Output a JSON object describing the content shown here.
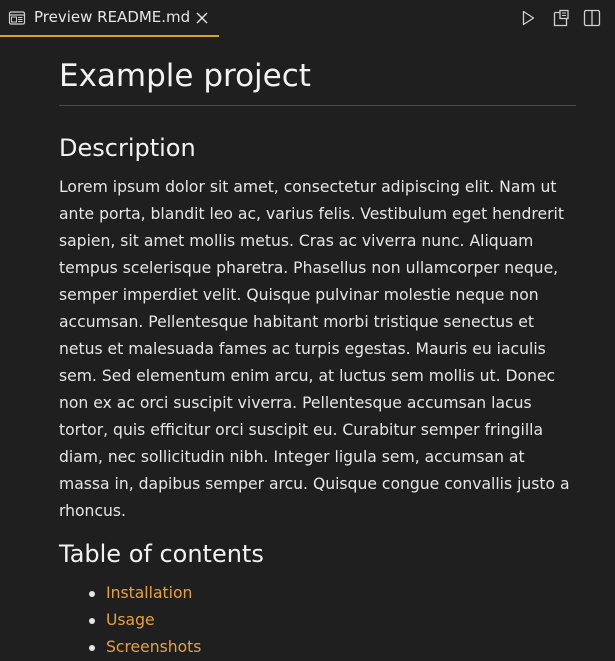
{
  "tab": {
    "icon": "preview-icon",
    "label": "Preview README.md",
    "close_icon": "close-icon"
  },
  "toolbar": {
    "run_icon": "play-icon",
    "open_source_icon": "open-file-icon",
    "split_icon": "split-editor-icon"
  },
  "colors": {
    "background": "#1f1f1f",
    "text": "#e6e6e6",
    "link": "#e8a23a",
    "active_tab_border": "#e0a030"
  },
  "document": {
    "title": "Example project",
    "description_heading": "Description",
    "description_text": "Lorem ipsum dolor sit amet, consectetur adipiscing elit. Nam ut ante porta, blandit leo ac, varius felis. Vestibulum eget hendrerit sapien, sit amet mollis metus. Cras ac viverra nunc. Aliquam tempus scelerisque pharetra. Phasellus non ullamcorper neque, semper imperdiet velit. Quisque pulvinar molestie neque non accumsan. Pellentesque habitant morbi tristique senectus et netus et malesuada fames ac turpis egestas. Mauris eu iaculis sem. Sed elementum enim arcu, at luctus sem mollis ut. Donec non ex ac orci suscipit viverra. Pellentesque accumsan lacus tortor, quis efficitur orci suscipit eu. Curabitur semper fringilla diam, nec sollicitudin nibh. Integer ligula sem, accumsan at massa in, dapibus semper arcu. Quisque congue convallis justo a rhoncus.",
    "toc_heading": "Table of contents",
    "toc_items": [
      {
        "label": "Installation"
      },
      {
        "label": "Usage"
      },
      {
        "label": "Screenshots"
      }
    ]
  }
}
